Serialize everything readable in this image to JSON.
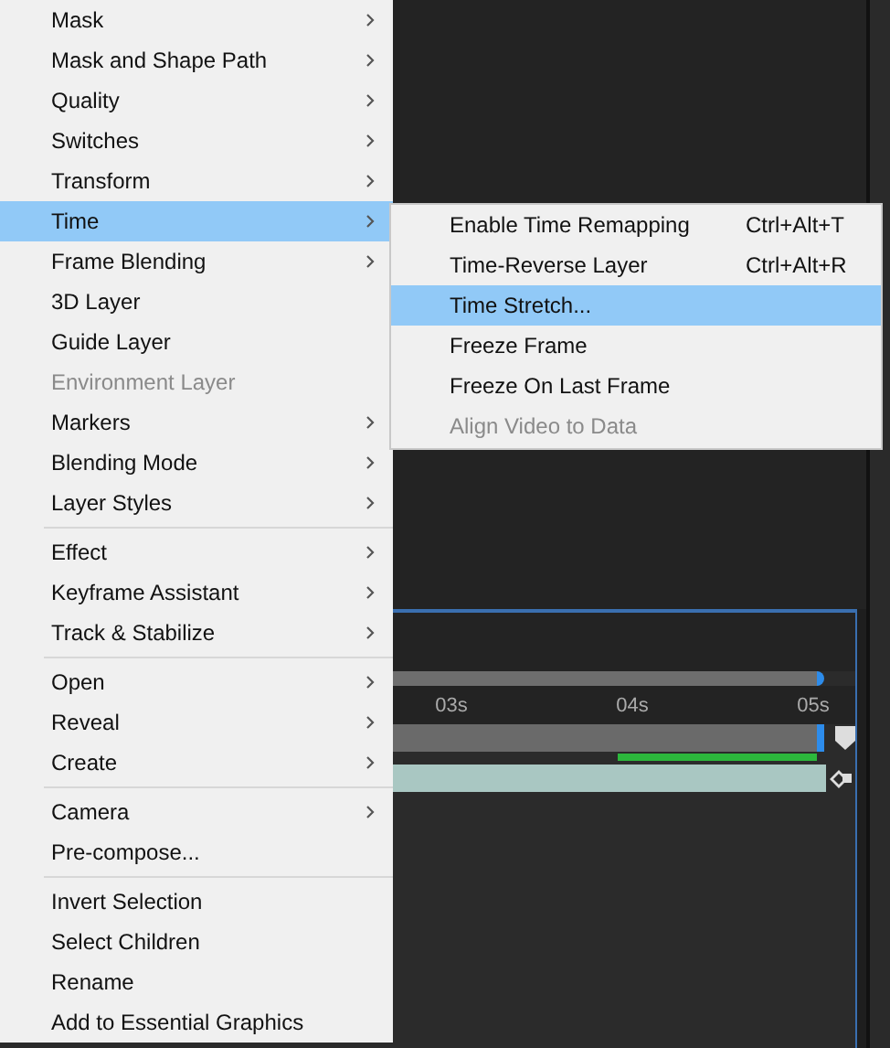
{
  "context_menu": {
    "groups": [
      [
        {
          "label": "Mask",
          "submenu": true,
          "selected": false,
          "disabled": false
        },
        {
          "label": "Mask and Shape Path",
          "submenu": true,
          "selected": false,
          "disabled": false
        },
        {
          "label": "Quality",
          "submenu": true,
          "selected": false,
          "disabled": false
        },
        {
          "label": "Switches",
          "submenu": true,
          "selected": false,
          "disabled": false
        },
        {
          "label": "Transform",
          "submenu": true,
          "selected": false,
          "disabled": false
        },
        {
          "label": "Time",
          "submenu": true,
          "selected": true,
          "disabled": false
        },
        {
          "label": "Frame Blending",
          "submenu": true,
          "selected": false,
          "disabled": false
        },
        {
          "label": "3D Layer",
          "submenu": false,
          "selected": false,
          "disabled": false
        },
        {
          "label": "Guide Layer",
          "submenu": false,
          "selected": false,
          "disabled": false
        },
        {
          "label": "Environment Layer",
          "submenu": false,
          "selected": false,
          "disabled": true
        },
        {
          "label": "Markers",
          "submenu": true,
          "selected": false,
          "disabled": false
        },
        {
          "label": "Blending Mode",
          "submenu": true,
          "selected": false,
          "disabled": false
        },
        {
          "label": "Layer Styles",
          "submenu": true,
          "selected": false,
          "disabled": false
        }
      ],
      [
        {
          "label": "Effect",
          "submenu": true,
          "selected": false,
          "disabled": false
        },
        {
          "label": "Keyframe Assistant",
          "submenu": true,
          "selected": false,
          "disabled": false
        },
        {
          "label": "Track & Stabilize",
          "submenu": true,
          "selected": false,
          "disabled": false
        }
      ],
      [
        {
          "label": "Open",
          "submenu": true,
          "selected": false,
          "disabled": false
        },
        {
          "label": "Reveal",
          "submenu": true,
          "selected": false,
          "disabled": false
        },
        {
          "label": "Create",
          "submenu": true,
          "selected": false,
          "disabled": false
        }
      ],
      [
        {
          "label": "Camera",
          "submenu": true,
          "selected": false,
          "disabled": false
        },
        {
          "label": "Pre-compose...",
          "submenu": false,
          "selected": false,
          "disabled": false
        }
      ],
      [
        {
          "label": "Invert Selection",
          "submenu": false,
          "selected": false,
          "disabled": false
        },
        {
          "label": "Select Children",
          "submenu": false,
          "selected": false,
          "disabled": false
        },
        {
          "label": "Rename",
          "submenu": false,
          "selected": false,
          "disabled": false
        },
        {
          "label": "Add to Essential Graphics",
          "submenu": false,
          "selected": false,
          "disabled": false
        }
      ]
    ]
  },
  "time_submenu": {
    "items": [
      {
        "label": "Enable Time Remapping",
        "shortcut": "Ctrl+Alt+T",
        "selected": false,
        "disabled": false
      },
      {
        "label": "Time-Reverse Layer",
        "shortcut": "Ctrl+Alt+R",
        "selected": false,
        "disabled": false
      },
      {
        "label": "Time Stretch...",
        "selected": true,
        "disabled": false
      },
      {
        "label": "Freeze Frame",
        "selected": false,
        "disabled": false
      },
      {
        "label": "Freeze On Last Frame",
        "selected": false,
        "disabled": false
      },
      {
        "label": "Align Video to Data",
        "selected": false,
        "disabled": true
      }
    ]
  },
  "timeline": {
    "ruler_labels": [
      "03s",
      "04s",
      "05s"
    ]
  }
}
